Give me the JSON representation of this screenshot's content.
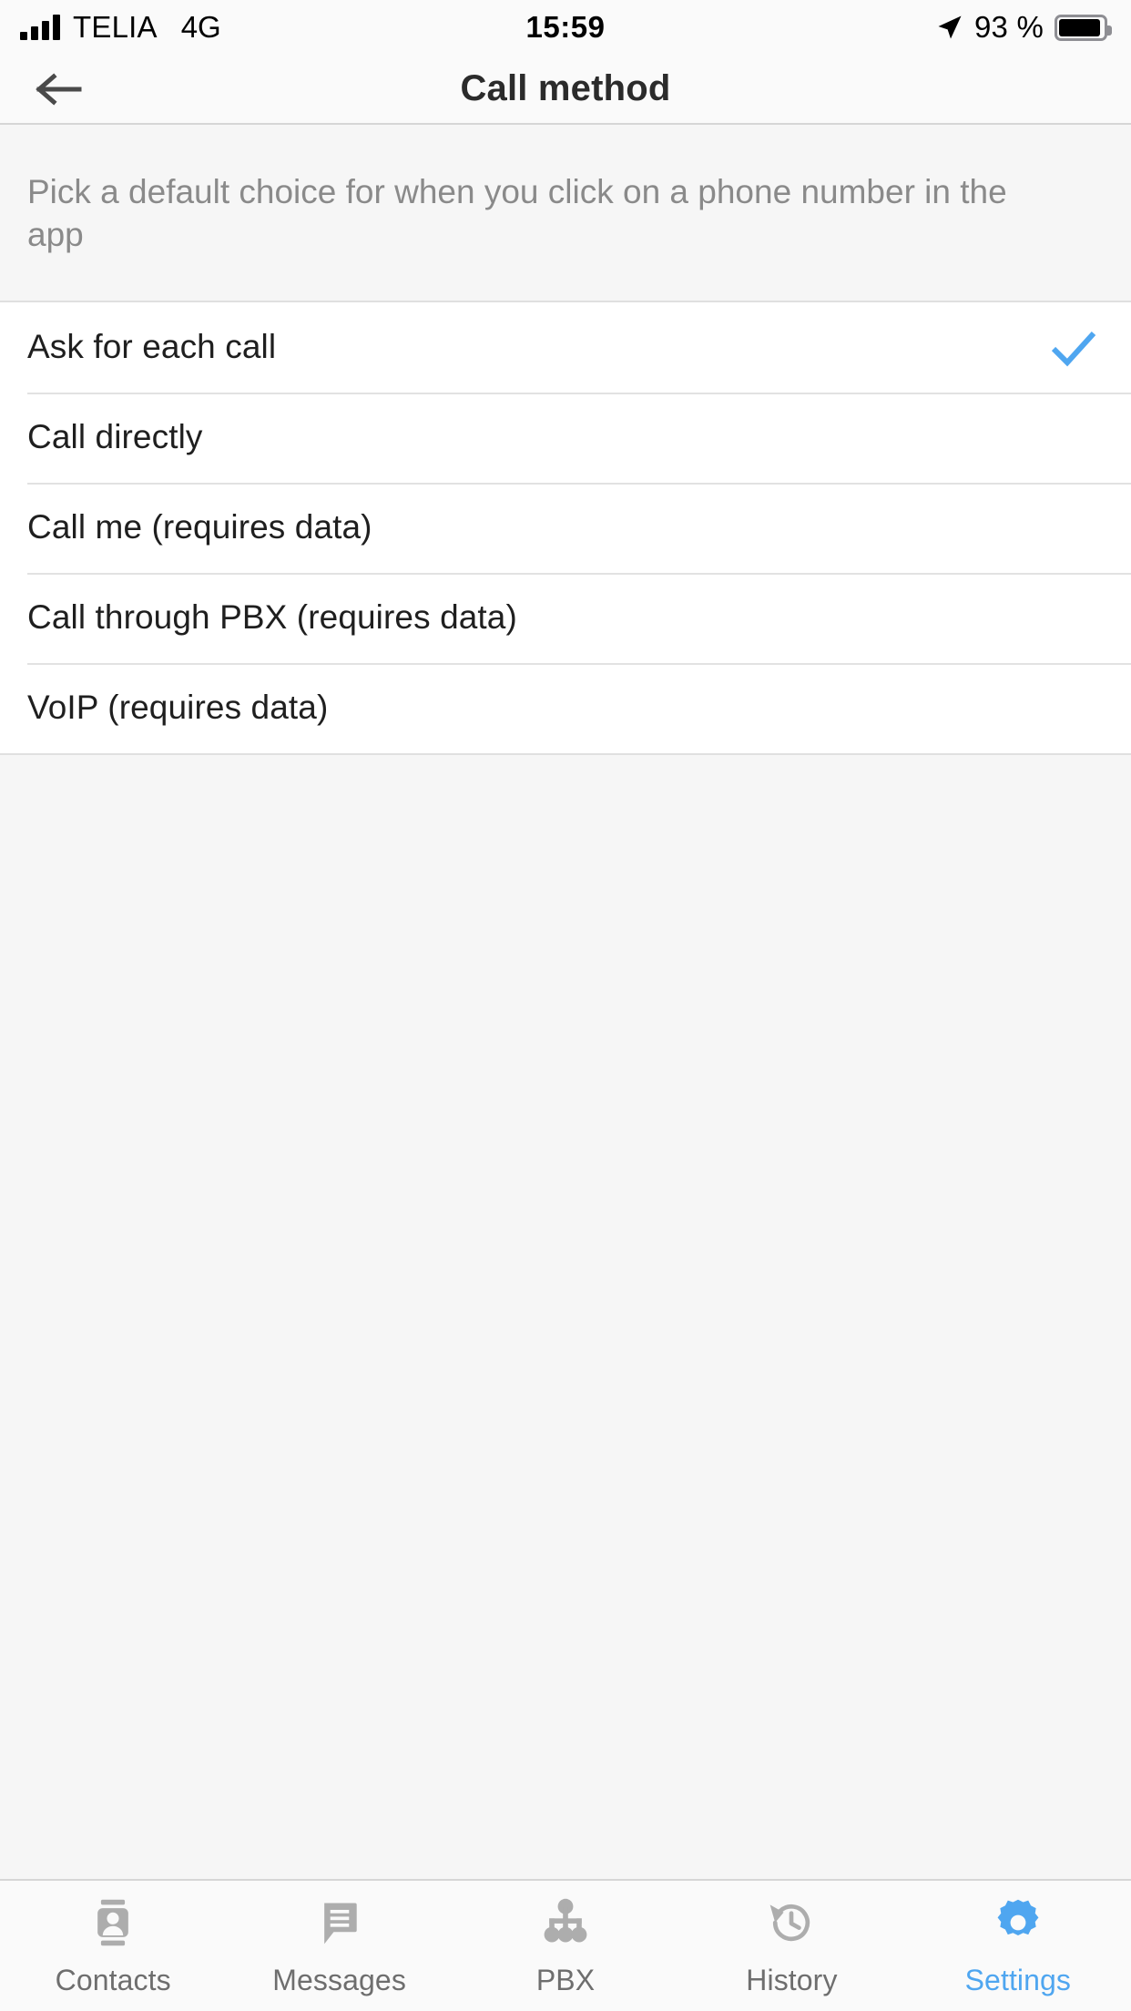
{
  "status_bar": {
    "carrier": "TELIA",
    "network": "4G",
    "time": "15:59",
    "battery_percent": "93 %",
    "battery_level": 93,
    "location_icon": "location-arrow-icon",
    "signal_icon": "signal-bars-icon",
    "battery_icon": "battery-icon"
  },
  "nav": {
    "back_icon": "back-arrow-icon",
    "title": "Call method"
  },
  "description": {
    "text": "Pick a default choice for when you click on a phone number in the app"
  },
  "options": {
    "selected_index": 0,
    "check_icon": "checkmark-icon",
    "items": [
      {
        "label": "Ask for each call",
        "selected": true
      },
      {
        "label": "Call directly",
        "selected": false
      },
      {
        "label": "Call me (requires data)",
        "selected": false
      },
      {
        "label": "Call through PBX (requires data)",
        "selected": false
      },
      {
        "label": "VoIP (requires data)",
        "selected": false
      }
    ]
  },
  "tab_bar": {
    "active_index": 4,
    "items": [
      {
        "label": "Contacts",
        "icon": "contact-card-icon",
        "active": false
      },
      {
        "label": "Messages",
        "icon": "speech-bubble-icon",
        "active": false
      },
      {
        "label": "PBX",
        "icon": "org-tree-icon",
        "active": false
      },
      {
        "label": "History",
        "icon": "clock-history-icon",
        "active": false
      },
      {
        "label": "Settings",
        "icon": "gear-icon",
        "active": true
      }
    ]
  },
  "colors": {
    "accent": "#4FA6F0",
    "inactive_icon": "#ADADAD",
    "inactive_label": "#6e6e6e",
    "body_text": "#1f1f1f",
    "muted_text": "#8a8a8a",
    "divider": "#e2e2e2",
    "page_bg": "#f6f6f6",
    "card_bg": "#ffffff"
  }
}
